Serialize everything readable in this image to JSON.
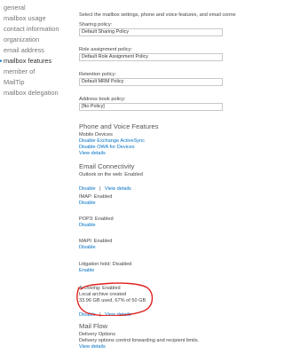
{
  "nav": {
    "items": [
      {
        "label": "general"
      },
      {
        "label": "mailbox usage"
      },
      {
        "label": "contact information"
      },
      {
        "label": "organization"
      },
      {
        "label": "email address"
      },
      {
        "label": "mailbox features"
      },
      {
        "label": "member of"
      },
      {
        "label": "MailTip"
      },
      {
        "label": "mailbox delegation"
      }
    ],
    "active_marker": "▸"
  },
  "main": {
    "intro": "Select the mailbox settings, phone and voice features, and email conne",
    "sharing_policy": {
      "label": "Sharing policy:",
      "value": "Default Sharing Policy"
    },
    "role_policy": {
      "label": "Role assignment policy:",
      "value": "Default Role Assignment Policy"
    },
    "retention_policy": {
      "label": "Retention policy:",
      "value": "Default MRM Policy"
    },
    "address_book_policy": {
      "label": "Address book policy:",
      "value": "[No Policy]"
    },
    "phone_voice": {
      "title": "Phone and Voice Features",
      "mobile_devices": "Mobile Devices",
      "disable_activesync": "Disable Exchange ActiveSync",
      "disable_owa_devices": "Disable OWA for Devices",
      "view_details": "View details"
    },
    "email_connectivity": {
      "title": "Email Connectivity",
      "owa_status": "Outlook on the web: Enabled",
      "disable": "Disable",
      "separator": "|",
      "view_details": "View details"
    },
    "imap": {
      "status": "IMAP: Enabled",
      "action": "Disable"
    },
    "pop3": {
      "status": "POP3: Enabled",
      "action": "Disable"
    },
    "mapi": {
      "status": "MAPI: Enabled",
      "action": "Disable"
    },
    "litigation": {
      "status": "Litigation hold: Disabled",
      "action": "Enable"
    },
    "archiving": {
      "status": "Archiving: Enabled",
      "local": "Local archive created",
      "usage": "33.96 GB used, 67% of 50 GB",
      "disable": "Disable",
      "separator": "|",
      "view_details": "View details"
    },
    "mail_flow": {
      "title": "Mail Flow",
      "delivery_options": "Delivery Options",
      "description": "Delivery options control forwarding and recipient limits.",
      "view_details": "View details"
    }
  },
  "colors": {
    "link": "#0072c6",
    "annotation": "#e02020",
    "text": "#444444",
    "field_border": "#c8c8c8"
  }
}
